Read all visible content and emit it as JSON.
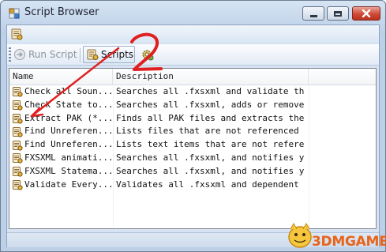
{
  "window": {
    "title": "Script Browser",
    "controls": [
      "minimize",
      "maximize",
      "close"
    ]
  },
  "menustrip": {
    "icon": "script-icon"
  },
  "toolbar": {
    "run_label": "Run Script",
    "run_enabled": false,
    "scripts_label": "Scripts",
    "config_icon": "gear-script-icon"
  },
  "list": {
    "columns": [
      "Name",
      "Description"
    ],
    "rows": [
      {
        "name": "Check all Soun...",
        "description": "Searches all .fxsxml and validate th..."
      },
      {
        "name": "Check State to...",
        "description": "Searches all .fxsxml, adds or remove..."
      },
      {
        "name": "Extract PAK (*...",
        "description": "Finds all PAK files and extracts the..."
      },
      {
        "name": "Find Unreferen...",
        "description": "Lists files that are not referenced"
      },
      {
        "name": "Find Unreferen...",
        "description": "Lists text items that are not refere..."
      },
      {
        "name": "FXSXML animati...",
        "description": "Searches all .fxsxml, and notifies y..."
      },
      {
        "name": "FXSXML Statema...",
        "description": "Searches all .fxsxml, and notifies y..."
      },
      {
        "name": "Validate Every...",
        "description": "Validates all .fxsxml and dependent ..."
      }
    ]
  },
  "watermark": {
    "text": "3DMGAME"
  },
  "annotation": {
    "number": "2",
    "color": "#e02020"
  }
}
